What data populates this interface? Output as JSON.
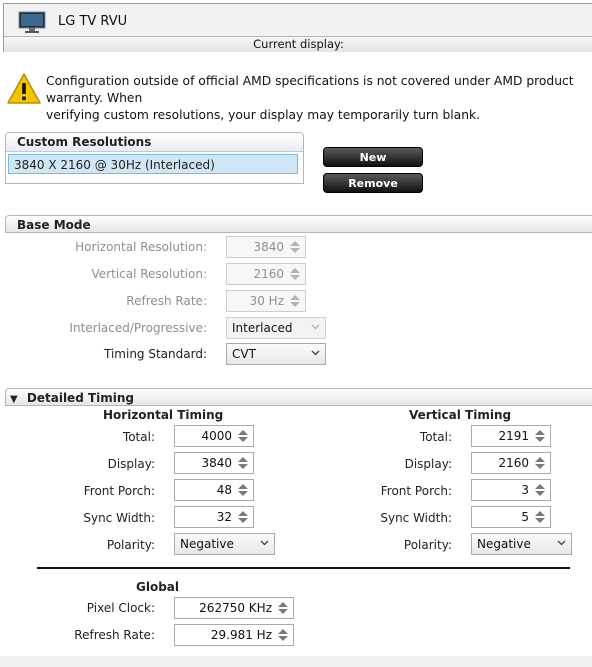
{
  "display": {
    "title": "LG TV RVU",
    "subtitle": "Current display:"
  },
  "warning": {
    "text": "Configuration outside of official AMD specifications is not covered under AMD product warranty. When\nverifying custom resolutions, your display may temporarily turn blank."
  },
  "custom_resolutions": {
    "header": "Custom Resolutions",
    "items": [
      "3840 X 2160 @ 30Hz (Interlaced)"
    ],
    "new_label": "New",
    "remove_label": "Remove"
  },
  "base_mode": {
    "header": "Base Mode",
    "horizontal_resolution": {
      "label": "Horizontal Resolution:",
      "value": "3840"
    },
    "vertical_resolution": {
      "label": "Vertical Resolution:",
      "value": "2160"
    },
    "refresh_rate": {
      "label": "Refresh Rate:",
      "value": "30 Hz"
    },
    "interlaced": {
      "label": "Interlaced/Progressive:",
      "value": "Interlaced"
    },
    "timing_standard": {
      "label": "Timing Standard:",
      "value": "CVT"
    }
  },
  "detailed_timing": {
    "header": "Detailed Timing",
    "collapse_glyph": "▼",
    "horizontal": {
      "title": "Horizontal Timing",
      "total": {
        "label": "Total:",
        "value": "4000"
      },
      "display": {
        "label": "Display:",
        "value": "3840"
      },
      "front_porch": {
        "label": "Front Porch:",
        "value": "48"
      },
      "sync_width": {
        "label": "Sync Width:",
        "value": "32"
      },
      "polarity": {
        "label": "Polarity:",
        "value": "Negative"
      }
    },
    "vertical": {
      "title": "Vertical Timing",
      "total": {
        "label": "Total:",
        "value": "2191"
      },
      "display": {
        "label": "Display:",
        "value": "2160"
      },
      "front_porch": {
        "label": "Front Porch:",
        "value": "3"
      },
      "sync_width": {
        "label": "Sync Width:",
        "value": "5"
      },
      "polarity": {
        "label": "Polarity:",
        "value": "Negative"
      }
    },
    "global": {
      "title": "Global",
      "pixel_clock": {
        "label": "Pixel Clock:",
        "value": "262750 KHz"
      },
      "refresh_rate": {
        "label": "Refresh Rate:",
        "value": "29.981 Hz"
      }
    }
  },
  "icons": {
    "display": "monitor-icon",
    "warning": "warning-icon",
    "spinner": "spinner-arrows-icon",
    "dropdown": "chevron-down-icon"
  },
  "colors": {
    "selection": "#cfe6f5",
    "warning_yellow": "#f5c400",
    "button_dark": "#222222"
  }
}
